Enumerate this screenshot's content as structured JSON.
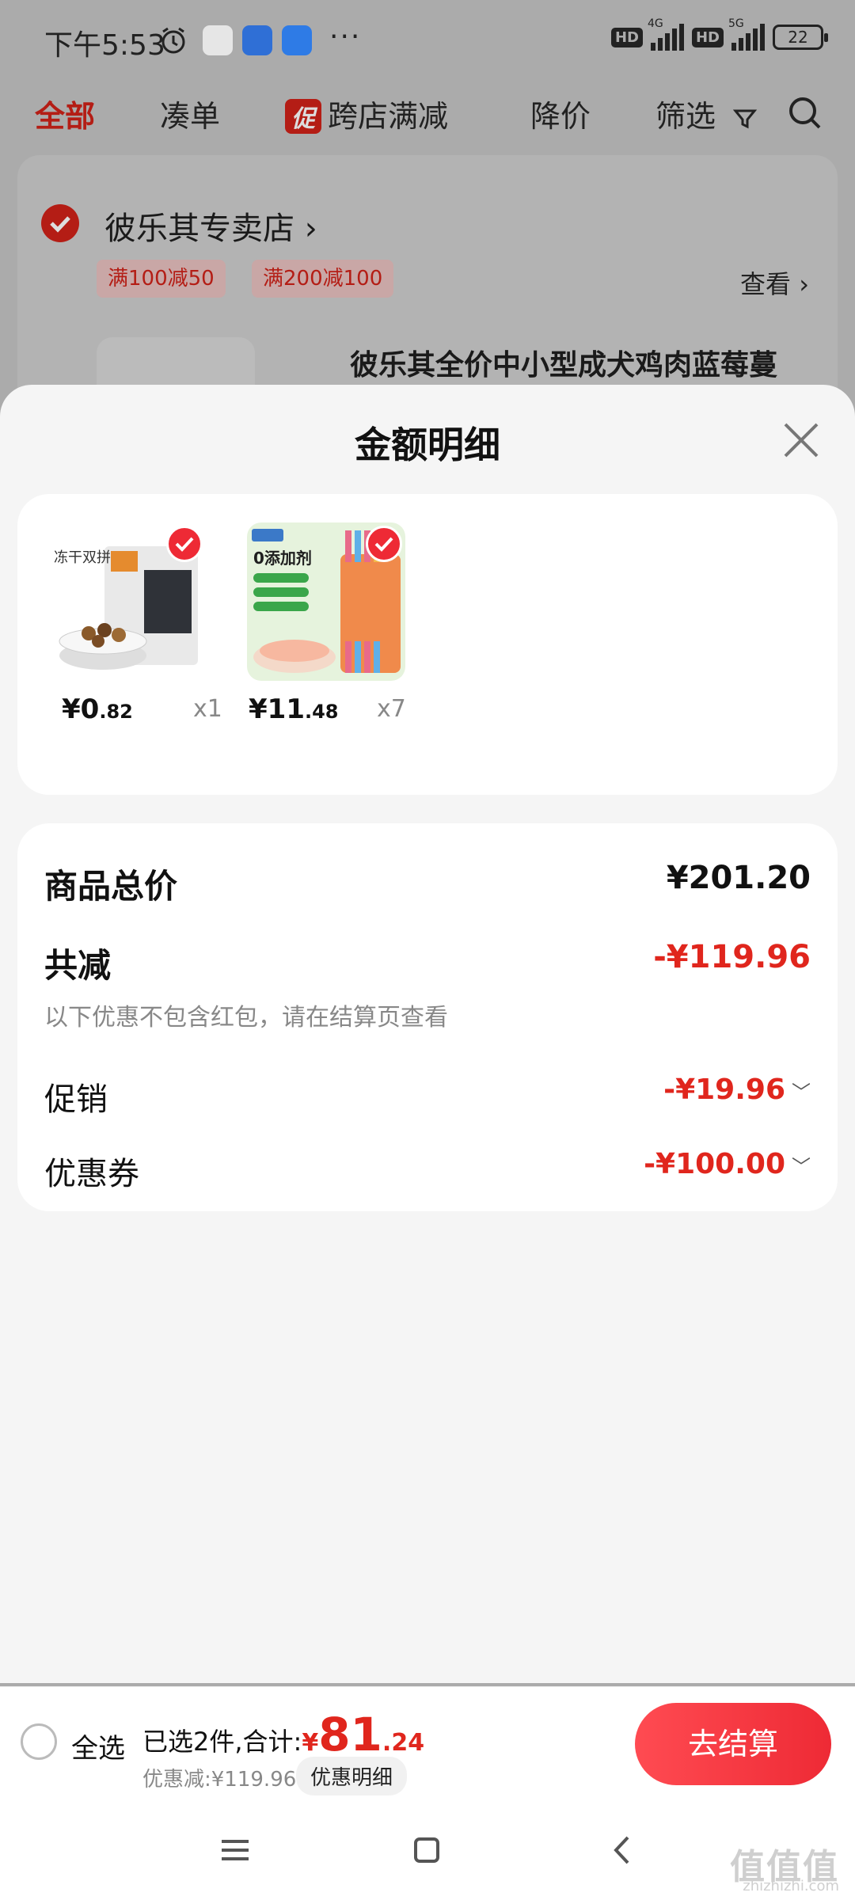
{
  "status_bar": {
    "time": "下午5:53",
    "hd1": "HD",
    "net1": "4G",
    "hd2": "HD",
    "net2": "5G",
    "battery": "22",
    "more": "···",
    "app_icons": [
      "alarm-icon",
      "video-app-icon",
      "wallet-app-icon",
      "car-app-icon"
    ]
  },
  "filter_tabs": {
    "all": "全部",
    "bundle": "凑单",
    "promo_badge": "促",
    "cross_store": "跨店满减",
    "price_drop": "降价",
    "filter": "筛选"
  },
  "store": {
    "name": "彼乐其专卖店",
    "coupons": [
      "满100减50",
      "满200减100"
    ],
    "view": "查看",
    "product_title": "彼乐其全价中小型成犬鸡肉蓝莓蔓"
  },
  "sheet": {
    "title": "金额明细",
    "items": [
      {
        "price_int": "¥0",
        "price_dec": ".82",
        "qty": "x1",
        "pkg_text": "冻干双拼"
      },
      {
        "price_int": "¥11",
        "price_dec": ".48",
        "qty": "x7",
        "pkg_text": "0添加剂"
      }
    ],
    "total_label": "商品总价",
    "total_value": "¥201.20",
    "discount_label": "共减",
    "discount_value": "-¥119.96",
    "discount_note": "以下优惠不包含红包，请在结算页查看",
    "promo_label": "促销",
    "promo_value": "-¥19.96",
    "coupon_label": "优惠券",
    "coupon_value": "-¥100.00"
  },
  "bottom_bar": {
    "select_all": "全选",
    "selected": "已选2件,合计:",
    "currency": "¥",
    "total_int": "81",
    "total_dec": ".24",
    "discount": "优惠减:¥119.96",
    "detail_btn": "优惠明细",
    "checkout": "去结算"
  },
  "watermark": {
    "main": "值值值",
    "sub": "zhizhizhi.com"
  },
  "colors": {
    "accent": "#e0261d",
    "checkout": "#ee2a35"
  }
}
